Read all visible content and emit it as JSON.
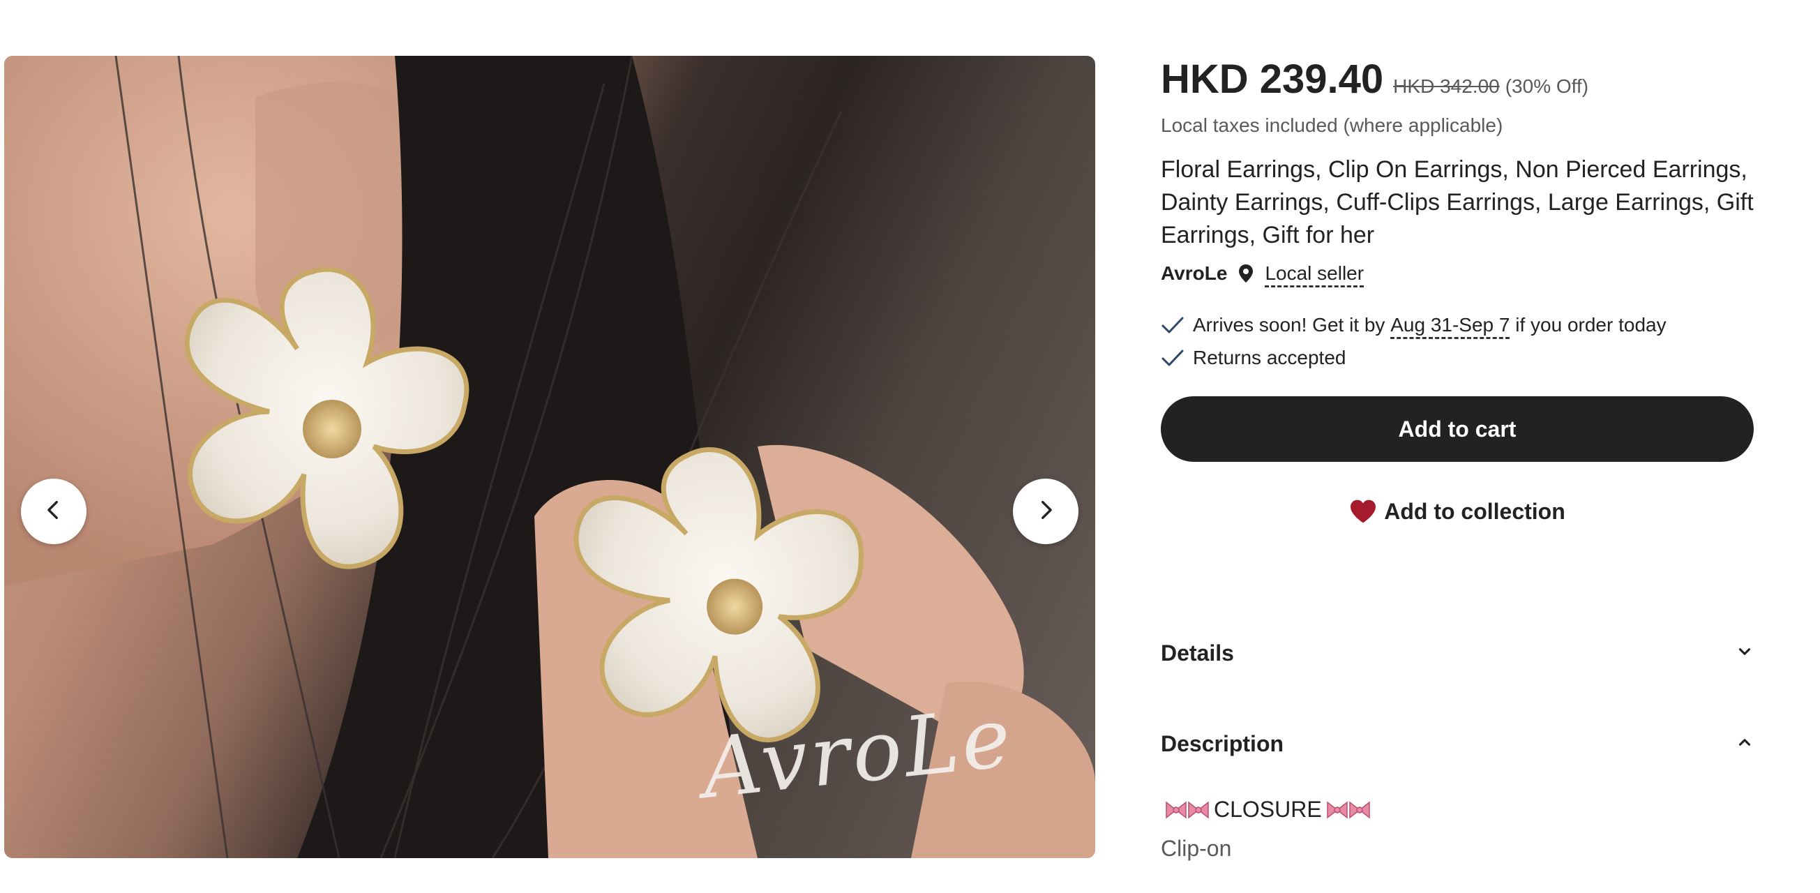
{
  "gallery": {
    "watermark_text": "AvroLe",
    "prev_icon": "chevron-left-icon",
    "next_icon": "chevron-right-icon"
  },
  "product": {
    "price": "HKD 239.40",
    "original_price": "HKD 342.00",
    "discount": "(30% Off)",
    "tax_note": "Local taxes included (where applicable)",
    "title": "Floral Earrings, Clip On Earrings, Non Pierced Earrings, Dainty Earrings, Cuff-Clips Earrings, Large Earrings, Gift Earrings, Gift for her"
  },
  "seller": {
    "name": "AvroLe",
    "local_label": "Local seller",
    "icon": "location-pin-icon"
  },
  "benefits": {
    "arrival_prefix": "Arrives soon! Get it by",
    "arrival_dates": "Aug 31-Sep 7",
    "arrival_suffix": "if you order today",
    "returns": "Returns accepted"
  },
  "actions": {
    "add_to_cart": "Add to cart",
    "add_to_collection": "Add to collection"
  },
  "sections": {
    "details": "Details",
    "description": "Description"
  },
  "description": {
    "closure_heading": "CLOSURE",
    "closure_value": "Clip-on"
  },
  "colors": {
    "button_dark": "#222222",
    "heart": "#a61a2e",
    "check": "#2f466c"
  }
}
